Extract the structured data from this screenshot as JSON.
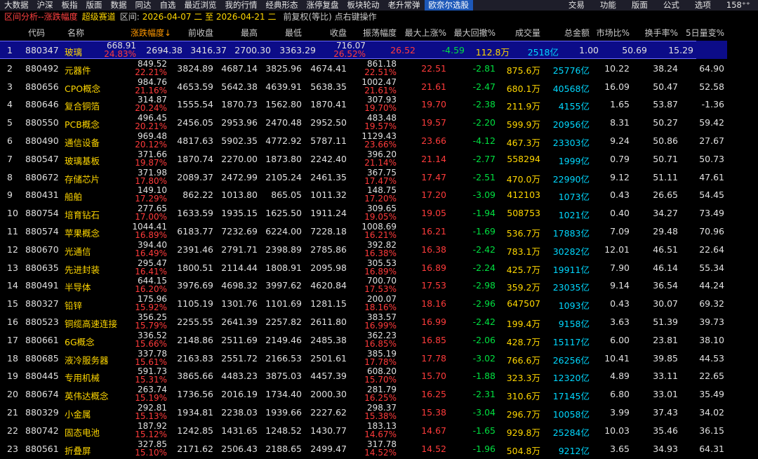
{
  "menu": {
    "items": [
      "大数据",
      "沪深",
      "板指",
      "版面",
      "数据",
      "同达",
      "自选",
      "最近浏览",
      "我的行情",
      "经典形态",
      "涨停复盘",
      "板块轮动",
      "老升常弹",
      "欧奈尔选股"
    ],
    "active_index": 13,
    "right_items": [
      "交易",
      "功能",
      "版面",
      "公式",
      "选项",
      "158⁺⁺"
    ]
  },
  "info": {
    "title": "区间分析--涨跌幅度",
    "mode": "超级赛道",
    "range_label": "区间:",
    "range": "2026-04-07 二 至 2026-04-21 二",
    "hint": "前复权(等比) 点右键操作"
  },
  "columns": {
    "code": "代码",
    "name": "名称",
    "chg": "涨跌幅度↓",
    "prev": "前收盘",
    "high": "最高",
    "low": "最低",
    "close": "收盘",
    "osc": "振荡幅度",
    "maxup": "最大上涨%",
    "maxdn": "最大回撤%",
    "vol": "成交量",
    "amt": "总金额",
    "mkt": "市场比%",
    "turn": "换手率%",
    "vchg": "5日量变%"
  },
  "rows": [
    {
      "idx": "1",
      "code": "880347",
      "name": "玻璃",
      "chg_abs": "668.91",
      "chg_pct": "24.83%",
      "prev": "2694.38",
      "high": "3416.37",
      "low": "2700.30",
      "close": "3363.29",
      "osc_abs": "716.07",
      "osc_pct": "26.52%",
      "maxup": "26.52",
      "maxdn": "-4.59",
      "vol": "112.8万",
      "amt": "2518亿",
      "mkt": "1.00",
      "turn": "50.69",
      "vchg": "15.29"
    },
    {
      "idx": "2",
      "code": "880492",
      "name": "元器件",
      "chg_abs": "849.52",
      "chg_pct": "22.21%",
      "prev": "3824.89",
      "high": "4687.14",
      "low": "3825.96",
      "close": "4674.41",
      "osc_abs": "861.18",
      "osc_pct": "22.51%",
      "maxup": "22.51",
      "maxdn": "-2.81",
      "vol": "875.6万",
      "amt": "25776亿",
      "mkt": "10.22",
      "turn": "38.24",
      "vchg": "64.90"
    },
    {
      "idx": "3",
      "code": "880656",
      "name": "CPO概念",
      "chg_abs": "984.76",
      "chg_pct": "21.16%",
      "prev": "4653.59",
      "high": "5642.38",
      "low": "4639.91",
      "close": "5638.35",
      "osc_abs": "1002.47",
      "osc_pct": "21.61%",
      "maxup": "21.61",
      "maxdn": "-2.47",
      "vol": "680.1万",
      "amt": "40568亿",
      "mkt": "16.09",
      "turn": "50.47",
      "vchg": "52.58"
    },
    {
      "idx": "4",
      "code": "880646",
      "name": "复合铜箔",
      "chg_abs": "314.87",
      "chg_pct": "20.24%",
      "prev": "1555.54",
      "high": "1870.73",
      "low": "1562.80",
      "close": "1870.41",
      "osc_abs": "307.93",
      "osc_pct": "19.70%",
      "maxup": "19.70",
      "maxdn": "-2.38",
      "vol": "211.9万",
      "amt": "4155亿",
      "mkt": "1.65",
      "turn": "53.87",
      "vchg": "-1.36"
    },
    {
      "idx": "5",
      "code": "880550",
      "name": "PCB概念",
      "chg_abs": "496.45",
      "chg_pct": "20.21%",
      "prev": "2456.05",
      "high": "2953.96",
      "low": "2470.48",
      "close": "2952.50",
      "osc_abs": "483.48",
      "osc_pct": "19.57%",
      "maxup": "19.57",
      "maxdn": "-2.20",
      "vol": "599.9万",
      "amt": "20956亿",
      "mkt": "8.31",
      "turn": "50.27",
      "vchg": "59.42"
    },
    {
      "idx": "6",
      "code": "880490",
      "name": "通信设备",
      "chg_abs": "969.48",
      "chg_pct": "20.12%",
      "prev": "4817.63",
      "high": "5902.35",
      "low": "4772.92",
      "close": "5787.11",
      "osc_abs": "1129.43",
      "osc_pct": "23.66%",
      "maxup": "23.66",
      "maxdn": "-4.12",
      "vol": "467.3万",
      "amt": "23303亿",
      "mkt": "9.24",
      "turn": "50.86",
      "vchg": "27.67"
    },
    {
      "idx": "7",
      "code": "880547",
      "name": "玻璃基板",
      "chg_abs": "371.66",
      "chg_pct": "19.87%",
      "prev": "1870.74",
      "high": "2270.00",
      "low": "1873.80",
      "close": "2242.40",
      "osc_abs": "396.20",
      "osc_pct": "21.14%",
      "maxup": "21.14",
      "maxdn": "-2.77",
      "vol": "558294",
      "amt": "1999亿",
      "mkt": "0.79",
      "turn": "50.71",
      "vchg": "50.73"
    },
    {
      "idx": "8",
      "code": "880672",
      "name": "存储芯片",
      "chg_abs": "371.98",
      "chg_pct": "17.80%",
      "prev": "2089.37",
      "high": "2472.99",
      "low": "2105.24",
      "close": "2461.35",
      "osc_abs": "367.75",
      "osc_pct": "17.47%",
      "maxup": "17.47",
      "maxdn": "-2.51",
      "vol": "470.0万",
      "amt": "22990亿",
      "mkt": "9.12",
      "turn": "51.11",
      "vchg": "47.61"
    },
    {
      "idx": "9",
      "code": "880431",
      "name": "船舶",
      "chg_abs": "149.10",
      "chg_pct": "17.29%",
      "prev": "862.22",
      "high": "1013.80",
      "low": "865.05",
      "close": "1011.32",
      "osc_abs": "148.75",
      "osc_pct": "17.20%",
      "maxup": "17.20",
      "maxdn": "-3.09",
      "vol": "412103",
      "amt": "1073亿",
      "mkt": "0.43",
      "turn": "26.65",
      "vchg": "54.45"
    },
    {
      "idx": "10",
      "code": "880754",
      "name": "培育钻石",
      "chg_abs": "277.65",
      "chg_pct": "17.00%",
      "prev": "1633.59",
      "high": "1935.15",
      "low": "1625.50",
      "close": "1911.24",
      "osc_abs": "309.65",
      "osc_pct": "19.05%",
      "maxup": "19.05",
      "maxdn": "-1.94",
      "vol": "508753",
      "amt": "1021亿",
      "mkt": "0.40",
      "turn": "34.27",
      "vchg": "73.49"
    },
    {
      "idx": "11",
      "code": "880574",
      "name": "苹果概念",
      "chg_abs": "1044.41",
      "chg_pct": "16.89%",
      "prev": "6183.77",
      "high": "7232.69",
      "low": "6224.00",
      "close": "7228.18",
      "osc_abs": "1008.69",
      "osc_pct": "16.21%",
      "maxup": "16.21",
      "maxdn": "-1.69",
      "vol": "536.7万",
      "amt": "17883亿",
      "mkt": "7.09",
      "turn": "29.48",
      "vchg": "70.96"
    },
    {
      "idx": "12",
      "code": "880670",
      "name": "光通信",
      "chg_abs": "394.40",
      "chg_pct": "16.49%",
      "prev": "2391.46",
      "high": "2791.71",
      "low": "2398.89",
      "close": "2785.86",
      "osc_abs": "392.82",
      "osc_pct": "16.38%",
      "maxup": "16.38",
      "maxdn": "-2.42",
      "vol": "783.1万",
      "amt": "30282亿",
      "mkt": "12.01",
      "turn": "46.51",
      "vchg": "22.64"
    },
    {
      "idx": "13",
      "code": "880635",
      "name": "先进封装",
      "chg_abs": "295.47",
      "chg_pct": "16.41%",
      "prev": "1800.51",
      "high": "2114.44",
      "low": "1808.91",
      "close": "2095.98",
      "osc_abs": "305.53",
      "osc_pct": "16.89%",
      "maxup": "16.89",
      "maxdn": "-2.24",
      "vol": "425.7万",
      "amt": "19911亿",
      "mkt": "7.90",
      "turn": "46.14",
      "vchg": "55.34"
    },
    {
      "idx": "14",
      "code": "880491",
      "name": "半导体",
      "chg_abs": "644.15",
      "chg_pct": "16.20%",
      "prev": "3976.69",
      "high": "4698.32",
      "low": "3997.62",
      "close": "4620.84",
      "osc_abs": "700.70",
      "osc_pct": "17.53%",
      "maxup": "17.53",
      "maxdn": "-2.98",
      "vol": "359.2万",
      "amt": "23035亿",
      "mkt": "9.14",
      "turn": "36.54",
      "vchg": "44.24"
    },
    {
      "idx": "15",
      "code": "880327",
      "name": "铅锌",
      "chg_abs": "175.96",
      "chg_pct": "15.92%",
      "prev": "1105.19",
      "high": "1301.76",
      "low": "1101.69",
      "close": "1281.15",
      "osc_abs": "200.07",
      "osc_pct": "18.16%",
      "maxup": "18.16",
      "maxdn": "-2.96",
      "vol": "647507",
      "amt": "1093亿",
      "mkt": "0.43",
      "turn": "30.07",
      "vchg": "69.32"
    },
    {
      "idx": "16",
      "code": "880523",
      "name": "铜缆高速连接",
      "chg_abs": "356.25",
      "chg_pct": "15.79%",
      "prev": "2255.55",
      "high": "2641.39",
      "low": "2257.82",
      "close": "2611.80",
      "osc_abs": "383.57",
      "osc_pct": "16.99%",
      "maxup": "16.99",
      "maxdn": "-2.42",
      "vol": "199.4万",
      "amt": "9158亿",
      "mkt": "3.63",
      "turn": "51.39",
      "vchg": "39.73"
    },
    {
      "idx": "17",
      "code": "880661",
      "name": "6G概念",
      "chg_abs": "336.52",
      "chg_pct": "15.66%",
      "prev": "2148.86",
      "high": "2511.69",
      "low": "2149.46",
      "close": "2485.38",
      "osc_abs": "362.23",
      "osc_pct": "16.85%",
      "maxup": "16.85",
      "maxdn": "-2.06",
      "vol": "428.7万",
      "amt": "15117亿",
      "mkt": "6.00",
      "turn": "23.81",
      "vchg": "38.10"
    },
    {
      "idx": "18",
      "code": "880685",
      "name": "液冷服务器",
      "chg_abs": "337.78",
      "chg_pct": "15.61%",
      "prev": "2163.83",
      "high": "2551.72",
      "low": "2166.53",
      "close": "2501.61",
      "osc_abs": "385.19",
      "osc_pct": "17.78%",
      "maxup": "17.78",
      "maxdn": "-3.02",
      "vol": "766.6万",
      "amt": "26256亿",
      "mkt": "10.41",
      "turn": "39.85",
      "vchg": "44.53"
    },
    {
      "idx": "19",
      "code": "880445",
      "name": "专用机械",
      "chg_abs": "591.73",
      "chg_pct": "15.31%",
      "prev": "3865.66",
      "high": "4483.23",
      "low": "3875.03",
      "close": "4457.39",
      "osc_abs": "608.20",
      "osc_pct": "15.70%",
      "maxup": "15.70",
      "maxdn": "-1.88",
      "vol": "323.3万",
      "amt": "12320亿",
      "mkt": "4.89",
      "turn": "33.11",
      "vchg": "22.65"
    },
    {
      "idx": "20",
      "code": "880674",
      "name": "英伟达概念",
      "chg_abs": "263.74",
      "chg_pct": "15.19%",
      "prev": "1736.56",
      "high": "2016.19",
      "low": "1734.40",
      "close": "2000.30",
      "osc_abs": "281.79",
      "osc_pct": "16.25%",
      "maxup": "16.25",
      "maxdn": "-2.31",
      "vol": "310.6万",
      "amt": "17145亿",
      "mkt": "6.80",
      "turn": "33.01",
      "vchg": "35.49"
    },
    {
      "idx": "21",
      "code": "880329",
      "name": "小金属",
      "chg_abs": "292.81",
      "chg_pct": "15.13%",
      "prev": "1934.81",
      "high": "2238.03",
      "low": "1939.66",
      "close": "2227.62",
      "osc_abs": "298.37",
      "osc_pct": "15.38%",
      "maxup": "15.38",
      "maxdn": "-3.04",
      "vol": "296.7万",
      "amt": "10058亿",
      "mkt": "3.99",
      "turn": "37.43",
      "vchg": "34.02"
    },
    {
      "idx": "22",
      "code": "880742",
      "name": "固态电池",
      "chg_abs": "187.92",
      "chg_pct": "15.12%",
      "prev": "1242.85",
      "high": "1431.65",
      "low": "1248.52",
      "close": "1430.77",
      "osc_abs": "183.13",
      "osc_pct": "14.67%",
      "maxup": "14.67",
      "maxdn": "-1.65",
      "vol": "929.8万",
      "amt": "25284亿",
      "mkt": "10.03",
      "turn": "35.46",
      "vchg": "36.15"
    },
    {
      "idx": "23",
      "code": "880561",
      "name": "折叠屏",
      "chg_abs": "327.85",
      "chg_pct": "15.10%",
      "prev": "2171.62",
      "high": "2506.43",
      "low": "2188.65",
      "close": "2499.47",
      "osc_abs": "317.78",
      "osc_pct": "14.52%",
      "maxup": "14.52",
      "maxdn": "-1.96",
      "vol": "504.8万",
      "amt": "9212亿",
      "mkt": "3.65",
      "turn": "34.93",
      "vchg": "64.31"
    }
  ],
  "selected_row": 0
}
